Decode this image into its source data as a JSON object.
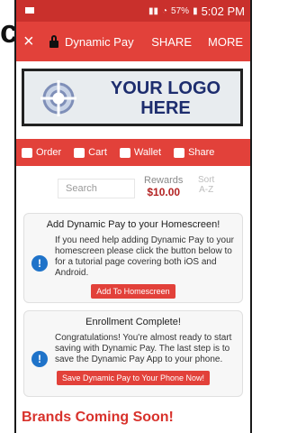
{
  "side": {
    "char": "c"
  },
  "status": {
    "time": "5:02 PM",
    "battery": "57%"
  },
  "appbar": {
    "close": "×",
    "title": "Dynamic Pay",
    "share": "SHARE",
    "more": "MORE"
  },
  "banner": {
    "line1": "YOUR LOGO",
    "line2": "HERE"
  },
  "nav": {
    "items": [
      {
        "label": "Order",
        "icon": "bag-icon"
      },
      {
        "label": "Cart",
        "icon": "cart-icon"
      },
      {
        "label": "Wallet",
        "icon": "wallet-icon"
      },
      {
        "label": "Share",
        "icon": "share-icon"
      }
    ]
  },
  "search": {
    "placeholder": "Search",
    "rewards_label": "Rewards",
    "rewards_value": "$10.00",
    "sort_label_1": "Sort",
    "sort_label_2": "A-Z"
  },
  "cards": [
    {
      "title": "Add Dynamic Pay to your Homescreen!",
      "text": "If you need help adding Dynamic Pay to your homescreen please click the button below to for a tutorial page covering both iOS and Android.",
      "button": "Add To Homescreen"
    },
    {
      "title": "Enrollment Complete!",
      "text": "Congratulations! You're almost ready to start saving with Dynamic Pay. The last step is to save the Dynamic Pay App to your phone.",
      "button": "Save Dynamic Pay to Your Phone Now!"
    }
  ],
  "footer": {
    "brands_title": "Brands Coming Soon!"
  },
  "colors": {
    "accent": "#e2413a",
    "status_bar": "#c9302c",
    "info_blue": "#1f73c9",
    "logo_text": "#1d2d6e"
  }
}
